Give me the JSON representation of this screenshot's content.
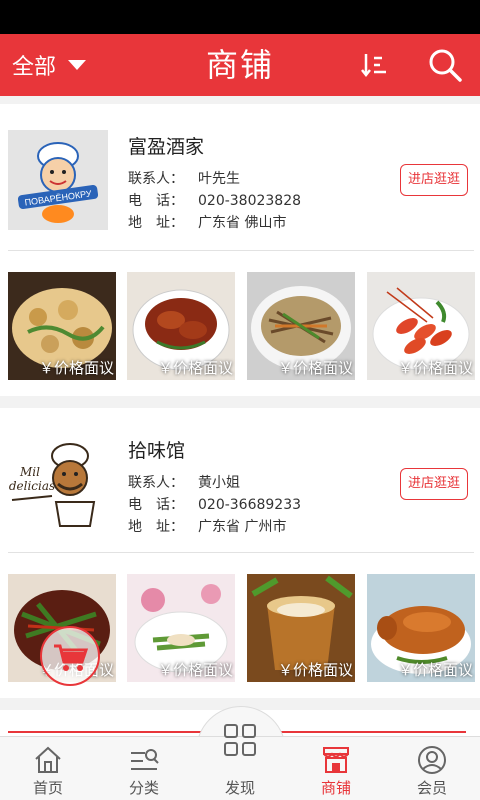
{
  "header": {
    "filter_label": "全部",
    "title": "商铺",
    "sort_icon": "sort-icon",
    "search_icon": "search-icon"
  },
  "colors": {
    "brand": "#e8363a",
    "nav_active": "#e8363a"
  },
  "shops": [
    {
      "name": "富盈酒家",
      "contact_label": "联系人：",
      "contact": "叶先生",
      "phone_label_a": "电",
      "phone_label_b": "话：",
      "phone": "020-38023828",
      "addr_label_a": "地",
      "addr_label_b": "址：",
      "address": "广东省 佛山市",
      "enter_label": "进店逛逛",
      "products": [
        {
          "price": "￥价格面议"
        },
        {
          "price": "￥价格面议"
        },
        {
          "price": "￥价格面议"
        },
        {
          "price": "￥价格面议"
        }
      ]
    },
    {
      "name": "拾味馆",
      "contact_label": "联系人：",
      "contact": "黄小姐",
      "phone_label_a": "电",
      "phone_label_b": "话：",
      "phone": "020-36689233",
      "addr_label_a": "地",
      "addr_label_b": "址：",
      "address": "广东省 广州市",
      "enter_label": "进店逛逛",
      "products": [
        {
          "price": "￥价格面议"
        },
        {
          "price": "￥价格面议"
        },
        {
          "price": "￥价格面议"
        },
        {
          "price": "￥价格面议"
        }
      ],
      "logo_text": "Mil delicias"
    }
  ],
  "bottom_nav": [
    {
      "label": "首页",
      "icon": "home-icon"
    },
    {
      "label": "分类",
      "icon": "category-icon"
    },
    {
      "label": "发现",
      "icon": "discover-icon"
    },
    {
      "label": "商铺",
      "icon": "shop-icon",
      "active": true
    },
    {
      "label": "会员",
      "icon": "member-icon"
    }
  ]
}
